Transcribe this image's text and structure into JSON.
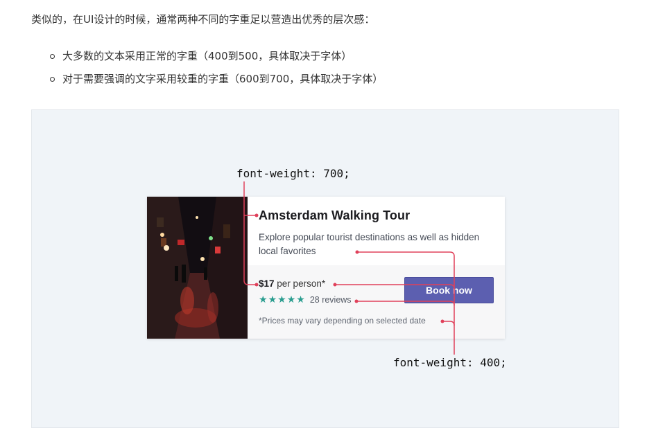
{
  "article": {
    "intro": "类似的，在UI设计的时候，通常两种不同的字重足以营造出优秀的层次感：",
    "bullets": [
      "大多数的文本采用正常的字重（400到500，具体取决于字体）",
      "对于需要强调的文字采用较重的字重（600到700，具体取决于字体）"
    ]
  },
  "figure": {
    "label_bold": "font-weight: 700;",
    "label_normal": "font-weight: 400;",
    "annotation_color": "#e0405a",
    "card": {
      "title": "Amsterdam Walking Tour",
      "description": "Explore popular tourist destinations as well as hidden local favorites",
      "price_amount": "$17",
      "price_unit": "per person*",
      "rating_stars": 5,
      "reviews": "28 reviews",
      "button_label": "Book now",
      "disclaimer": "*Prices may vary depending on selected date",
      "photo_icon": "night-street-photo",
      "accent_color": "#5c5fb0",
      "star_color": "#2a9d8f"
    }
  }
}
